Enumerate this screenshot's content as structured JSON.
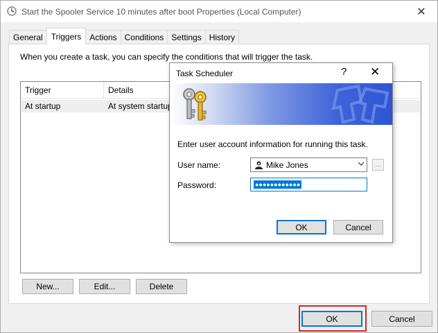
{
  "window": {
    "title": "Start the Spooler Service 10 minutes after boot Properties (Local Computer)",
    "close_glyph": "✕"
  },
  "tabs": [
    {
      "label": "General"
    },
    {
      "label": "Triggers",
      "active": true
    },
    {
      "label": "Actions"
    },
    {
      "label": "Conditions"
    },
    {
      "label": "Settings"
    },
    {
      "label": "History"
    }
  ],
  "triggers_tab": {
    "description": "When you create a task, you can specify the conditions that will trigger the task.",
    "columns": [
      "Trigger",
      "Details"
    ],
    "rows": [
      {
        "trigger": "At startup",
        "details": "At system startup"
      }
    ],
    "buttons": {
      "new": "New...",
      "edit": "Edit...",
      "delete": "Delete"
    }
  },
  "footer": {
    "ok": "OK",
    "cancel": "Cancel"
  },
  "dialog": {
    "title": "Task Scheduler",
    "help_glyph": "?",
    "close_glyph": "✕",
    "message": "Enter user account information for running this task.",
    "username_label": "User name:",
    "username_value": "Mike Jones",
    "password_label": "Password:",
    "password_mask": "●●●●●●●●●●●●",
    "browse_label": "...",
    "ok": "OK",
    "cancel": "Cancel"
  },
  "colors": {
    "accent": "#0078d7",
    "highlight_box": "#d7262a",
    "banner_blue": "#2e55d3"
  },
  "icons": [
    "clock-icon",
    "keys-icon",
    "user-icon",
    "chevron-down-icon",
    "close-icon",
    "help-icon"
  ]
}
